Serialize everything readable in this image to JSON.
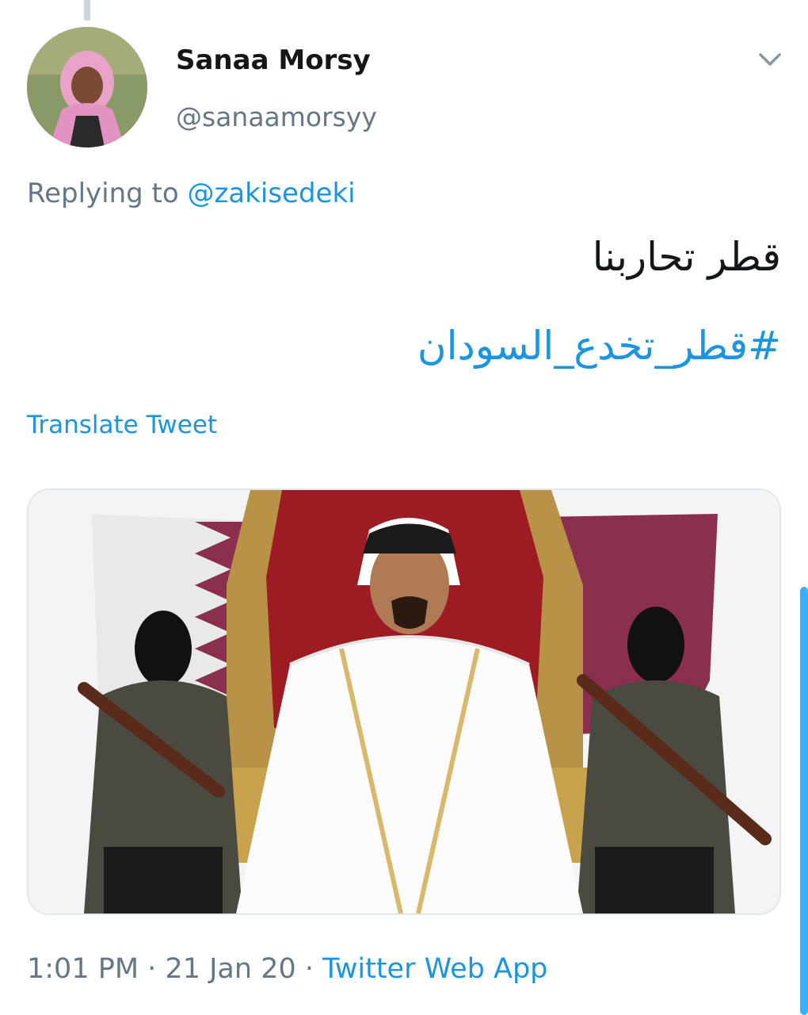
{
  "tweet": {
    "display_name": "Sanaa Morsy",
    "handle": "@sanaamorsyy",
    "replying_prefix": "Replying to",
    "replying_to": "@zakisedeki",
    "text": "قطر تحاربنا",
    "hashtag": "#قطر_تخدع_السودان",
    "translate_label": "Translate Tweet",
    "time": "1:01 PM",
    "separator": "·",
    "date": "21 Jan 20",
    "source": "Twitter Web App"
  },
  "icons": {
    "more": "chevron-down-icon"
  },
  "colors": {
    "link": "#1b95e0",
    "secondary_text": "#657786",
    "primary_text": "#14171a",
    "border": "#e1e8ed",
    "scrollbar": "#1da1f2"
  }
}
